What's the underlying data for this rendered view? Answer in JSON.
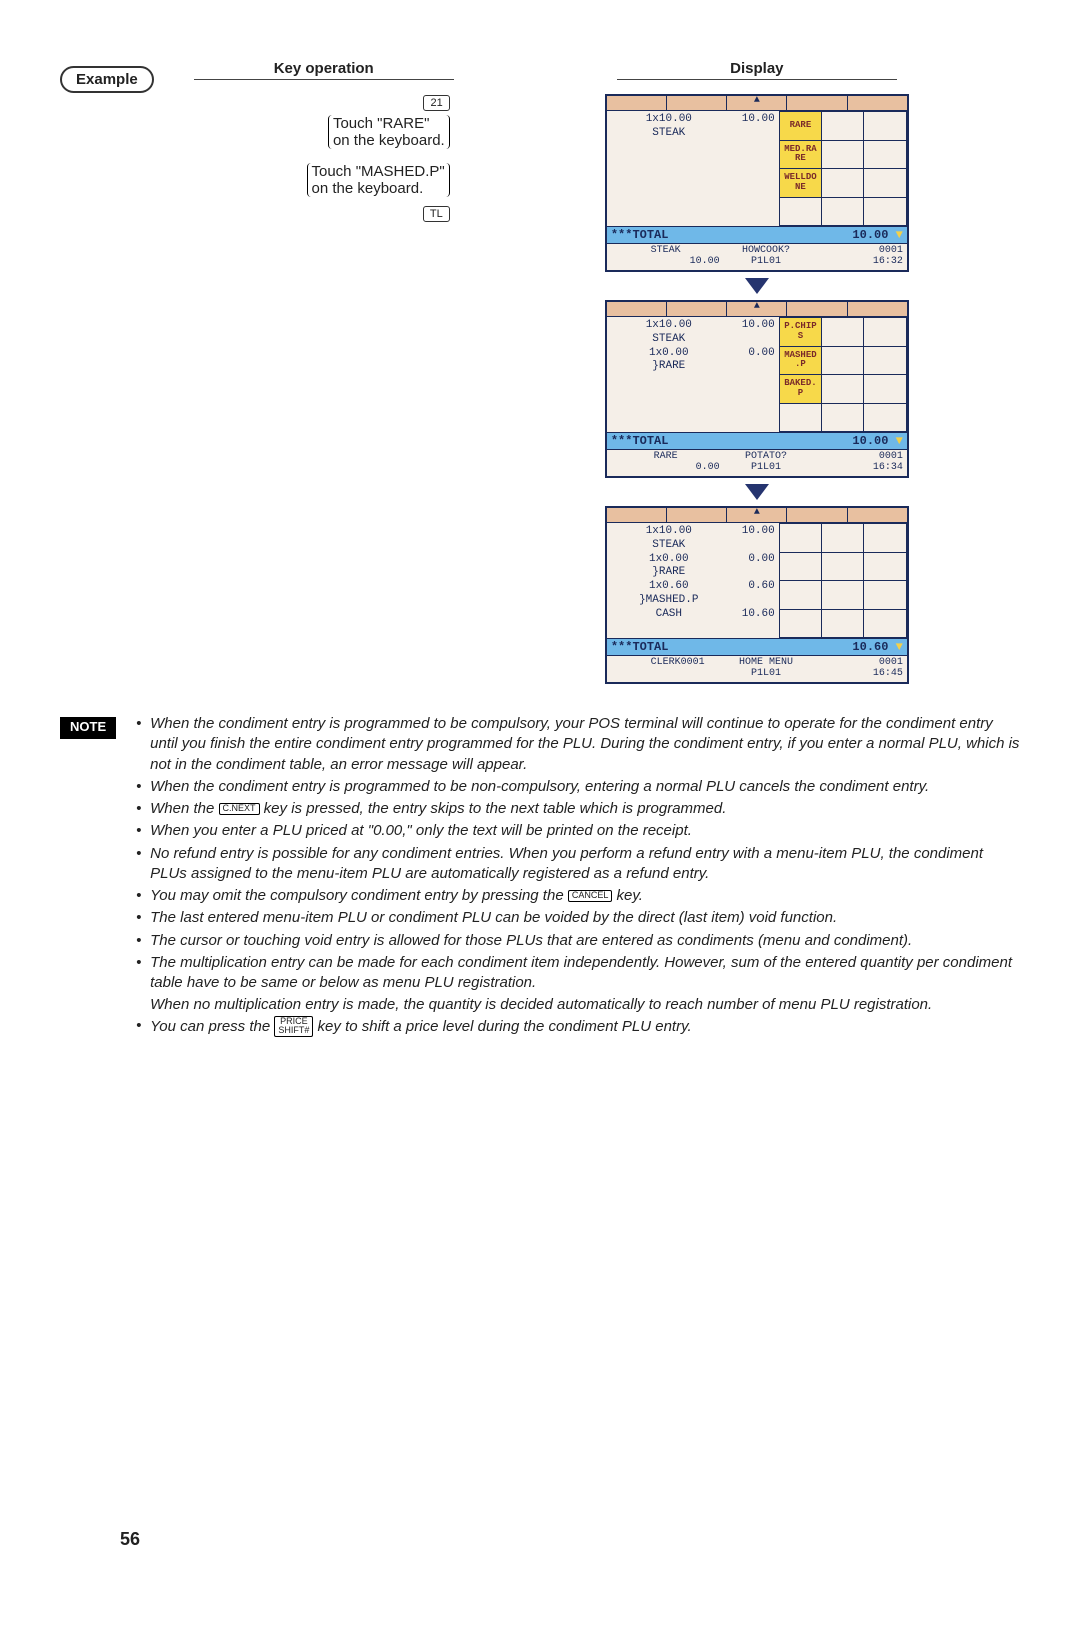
{
  "labels": {
    "example": "Example",
    "keyop": "Key operation",
    "display": "Display",
    "note": "NOTE"
  },
  "keyop": {
    "btn21": "21",
    "l1a": "Touch \"RARE\"",
    "l1b": "on the keyboard.",
    "l2a": "Touch \"MASHED.P\"",
    "l2b": "on the keyboard.",
    "btnTL": "TL"
  },
  "screens": [
    {
      "lines": [
        {
          "l": "1x10.00",
          "r": "10.00"
        },
        {
          "l": "STEAK",
          "r": ""
        }
      ],
      "buttons": [
        "RARE",
        "",
        "",
        "MED.RA\nRE",
        "",
        "",
        "WELLDO\nNE",
        "",
        "",
        "",
        "",
        ""
      ],
      "on": [
        0,
        3,
        6
      ],
      "total": {
        "l": "***TOTAL",
        "r": "10.00"
      },
      "down": "▼",
      "status": {
        "c1": "STEAK\n             10.00",
        "c2": "HOWCOOK?\nP1L01",
        "c3": "0001\n16:32"
      }
    },
    {
      "lines": [
        {
          "l": "1x10.00",
          "r": "10.00"
        },
        {
          "l": "STEAK",
          "r": ""
        },
        {
          "l": "1x0.00",
          "r": "0.00"
        },
        {
          "l": "}RARE",
          "r": ""
        }
      ],
      "buttons": [
        "P.CHIP\nS",
        "",
        "",
        "MASHED\n.P",
        "",
        "",
        "BAKED.\nP",
        "",
        "",
        "",
        "",
        ""
      ],
      "on": [
        0,
        3,
        6
      ],
      "total": {
        "l": "***TOTAL",
        "r": "10.00"
      },
      "down": "▼",
      "status": {
        "c1": "RARE\n              0.00",
        "c2": "POTATO?\nP1L01",
        "c3": "0001\n16:34"
      }
    },
    {
      "lines": [
        {
          "l": "1x10.00",
          "r": "10.00"
        },
        {
          "l": "STEAK",
          "r": ""
        },
        {
          "l": "1x0.00",
          "r": "0.00"
        },
        {
          "l": "}RARE",
          "r": ""
        },
        {
          "l": "1x0.60",
          "r": "0.60"
        },
        {
          "l": "}MASHED.P",
          "r": ""
        },
        {
          "l": "CASH",
          "r": "10.60"
        }
      ],
      "buttons": [
        "",
        "",
        "",
        "",
        "",
        "",
        "",
        "",
        "",
        "",
        "",
        ""
      ],
      "on": [],
      "total": {
        "l": "***TOTAL",
        "r": "10.60"
      },
      "down": "▼",
      "status": {
        "c1": "    CLERK0001",
        "c2": "HOME MENU\nP1L01",
        "c3": "0001\n16:45"
      }
    }
  ],
  "notes": {
    "n1": "When the condiment entry is programmed to be compulsory, your POS terminal will continue to operate for the condiment entry until you finish the entire condiment entry programmed for the PLU.  During the condiment entry, if you enter a normal PLU, which is not in the condiment table, an error message will appear.",
    "n2": "When the condiment entry is programmed to be non-compulsory, entering a normal PLU cancels the condiment entry.",
    "n3a": "When the ",
    "n3key": "C.NEXT",
    "n3b": " key is pressed, the entry skips to the next table which is programmed.",
    "n4": "When you enter a PLU priced at \"0.00,\" only the text will be printed on the receipt.",
    "n5": "No refund entry is possible for any condiment entries.  When you perform a refund entry with a menu-item PLU, the condiment PLUs assigned to the menu-item PLU are automatically registered as a refund entry.",
    "n6a": "You may omit the compulsory condiment entry by pressing the ",
    "n6key": "CANCEL",
    "n6b": " key.",
    "n7": "The last entered menu-item PLU or condiment PLU can be voided by the direct (last item) void function.",
    "n8": "The cursor or touching void entry is allowed for those PLUs that are entered as condiments (menu and condiment).",
    "n9": "The multiplication entry can be made for each condiment item independently.  However, sum of the entered quantity per condiment table have to be same or below as menu PLU registration.",
    "n9cont": "When no multiplication entry is made, the quantity is decided automatically to reach number of menu PLU registration.",
    "n10a": "You can press the ",
    "n10key": "PRICE\nSHIFT#",
    "n10b": " key to shift a price level during the condiment PLU entry."
  },
  "pagenum": "56"
}
